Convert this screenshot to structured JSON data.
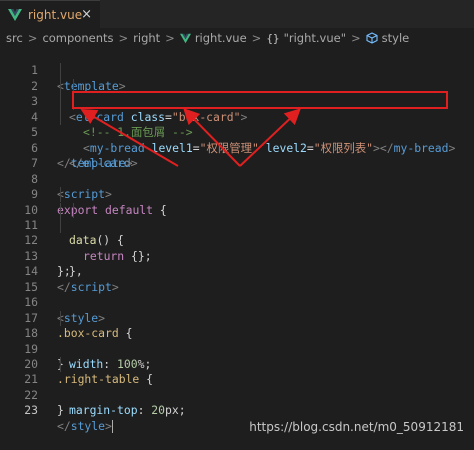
{
  "tab": {
    "filename": "right.vue",
    "close_glyph": "×",
    "icon": "vue-logo-icon"
  },
  "breadcrumb": {
    "items": [
      "src",
      "components",
      "right",
      "right.vue",
      "\"right.vue\"",
      "style"
    ],
    "separator": ">",
    "braces": "{}"
  },
  "editor": {
    "line_numbers": [
      "1",
      "2",
      "3",
      "4",
      "5",
      "6",
      "7",
      "8",
      "9",
      "10",
      "11",
      "12",
      "13",
      "14",
      "15",
      "16",
      "17",
      "18",
      "19",
      "20",
      "21",
      "22",
      "23"
    ],
    "active_line": "23",
    "code": {
      "l1": [
        "<",
        "template",
        ">"
      ],
      "l2": [
        "<",
        "el-card",
        " ",
        "class",
        "=",
        "\"box-card\"",
        ">"
      ],
      "l3": "<!-- 1.面包屑 -->",
      "l4": [
        "<",
        "my-bread",
        " ",
        "level1",
        "=",
        "\"权限管理\"",
        " ",
        "level2",
        "=",
        "\"权限列表\"",
        "></",
        "my-bread",
        ">"
      ],
      "l5": [
        "</",
        "el-card",
        ">"
      ],
      "l6": [
        "</",
        "template",
        ">"
      ],
      "l8": [
        "<",
        "script",
        ">"
      ],
      "l9": [
        "export",
        " ",
        "default",
        " {"
      ],
      "l10": [
        "data",
        "() {"
      ],
      "l11": [
        "return",
        " {};"
      ],
      "l12": "},",
      "l13": "};",
      "l14": [
        "</",
        "script",
        ">"
      ],
      "l16": [
        "<",
        "style",
        ">"
      ],
      "l17": [
        ".box-card",
        " {"
      ],
      "l18": [
        "width",
        ": ",
        "100",
        "%;"
      ],
      "l19": "}",
      "l20": [
        ".right-table",
        " {"
      ],
      "l21": [
        "margin-top",
        ": ",
        "20",
        "px;"
      ],
      "l22": "}",
      "l23": [
        "</",
        "style",
        ">"
      ]
    }
  },
  "annotation": {
    "highlight_color": "#e02020",
    "arrow_count": 3
  },
  "watermark": "https://blog.csdn.net/m0_50912181",
  "colors": {
    "background": "#1e1e1e",
    "tag": "#569cd6",
    "attribute": "#9cdcfe",
    "string": "#ce9178",
    "comment": "#6a9955",
    "keyword": "#c586c0",
    "number": "#b5cea8"
  }
}
